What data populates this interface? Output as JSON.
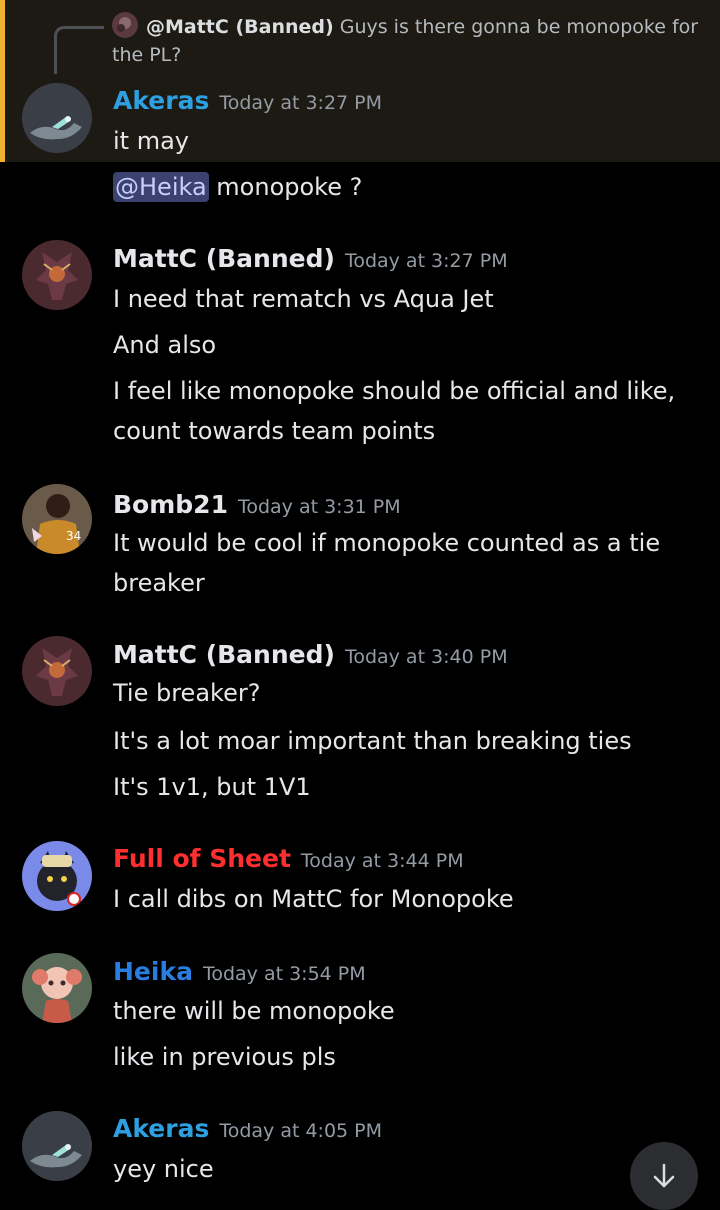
{
  "colors": {
    "background": "#000000",
    "highlight_bg": "#1c1a12",
    "highlight_bar": "#f0b132",
    "text": "#e6e7ea",
    "timestamp": "#949ba4",
    "author_blue": "#2e9fe0",
    "author_red": "#ff2f2f",
    "author_white": "#e6e7ea",
    "mention_bg": "#3c4270"
  },
  "reply": {
    "author": "@MattC (Banned)",
    "text": "Guys is there gonna be monopoke for the PL?"
  },
  "messages": [
    {
      "author": "Akeras",
      "timestamp": "Today at 3:27 PM",
      "avatar_icon": "akeras-avatar",
      "lines": [
        "it may"
      ],
      "mention": "@Heika",
      "mention_rest": " monopoke ?"
    },
    {
      "author": "MattC (Banned)",
      "timestamp": "Today at 3:27 PM",
      "avatar_icon": "mattc-avatar",
      "lines": [
        "I need that rematch vs Aqua Jet",
        "And also",
        "I feel like monopoke should be official and like,",
        "count towards team points"
      ]
    },
    {
      "author": "Bomb21",
      "timestamp": "Today at 3:31 PM",
      "avatar_icon": "bomb21-avatar",
      "lines": [
        "It would be cool if monopoke counted as a tie",
        "breaker"
      ]
    },
    {
      "author": "MattC (Banned)",
      "timestamp": "Today at 3:40 PM",
      "avatar_icon": "mattc-avatar",
      "lines": [
        "Tie breaker?",
        "It's a lot moar important than breaking ties",
        "It's 1v1, but 1V1"
      ]
    },
    {
      "author": "Full of Sheet",
      "timestamp": "Today at 3:44 PM",
      "avatar_icon": "fullofsheet-avatar",
      "lines": [
        "I call dibs on MattC for Monopoke"
      ]
    },
    {
      "author": "Heika",
      "timestamp": "Today at 3:54 PM",
      "avatar_icon": "heika-avatar",
      "lines": [
        "there will be monopoke",
        "like in previous pls"
      ]
    },
    {
      "author": "Akeras",
      "timestamp": "Today at 4:05 PM",
      "avatar_icon": "akeras-avatar",
      "lines": [
        "yey nice"
      ]
    }
  ],
  "scroll_button_icon": "arrow-down-icon"
}
